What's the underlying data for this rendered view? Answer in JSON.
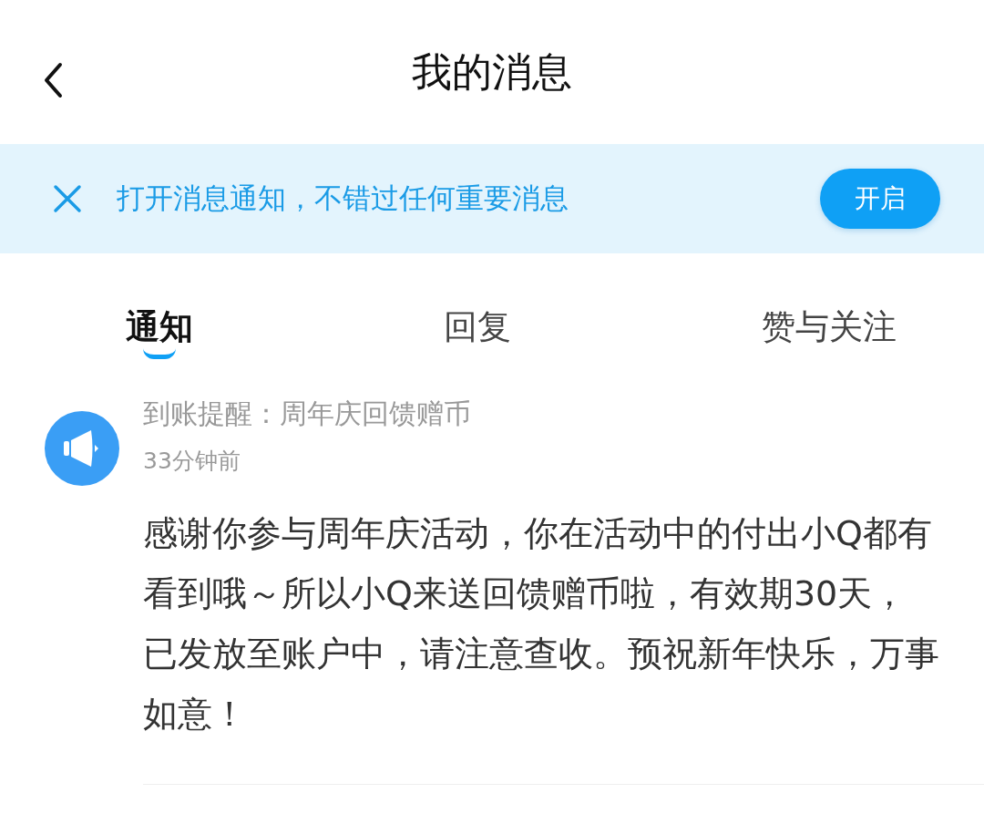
{
  "header": {
    "title": "我的消息"
  },
  "banner": {
    "text": "打开消息通知，不错过任何重要消息",
    "button": "开启"
  },
  "tabs": [
    {
      "label": "通知",
      "selected": true
    },
    {
      "label": "回复",
      "selected": false
    },
    {
      "label": "赞与关注",
      "selected": false
    }
  ],
  "messages": [
    {
      "title": "到账提醒：周年庆回馈赠币",
      "time": "33分钟前",
      "body": "感谢你参与周年庆活动，你在活动中的付出小Q都有看到哦～所以小Q来送回馈赠币啦，有效期30天，已发放至账户中，请注意查收。预祝新年快乐，万事如意！"
    }
  ]
}
